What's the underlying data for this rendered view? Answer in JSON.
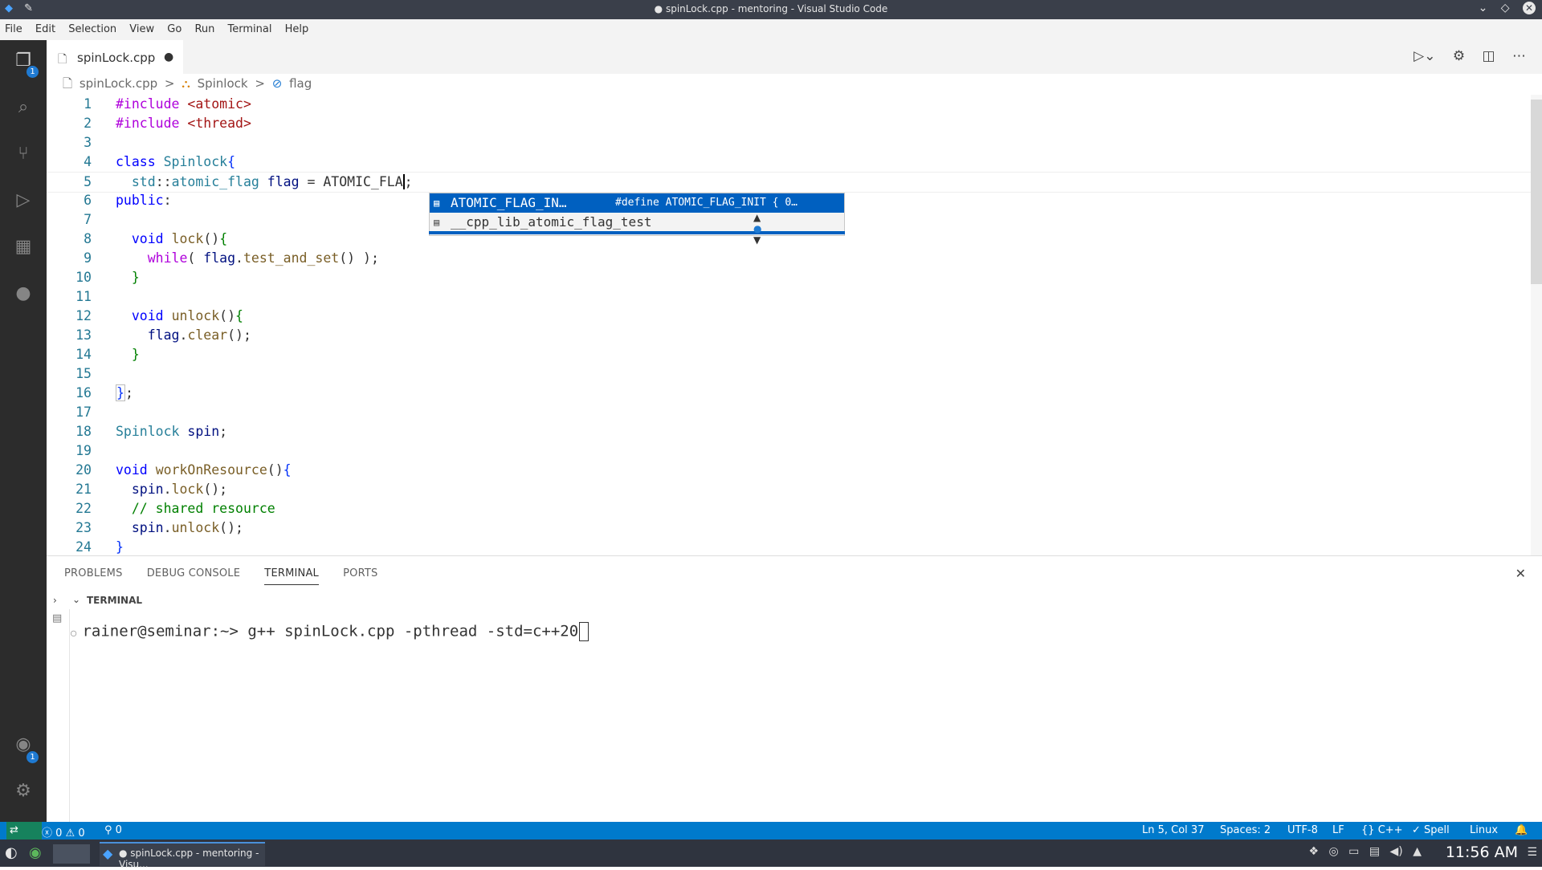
{
  "window": {
    "title": "● spinLock.cpp - mentoring - Visual Studio Code"
  },
  "menu": [
    "File",
    "Edit",
    "Selection",
    "View",
    "Go",
    "Run",
    "Terminal",
    "Help"
  ],
  "activity": {
    "icons": [
      "files-icon",
      "search-icon",
      "source-control-icon",
      "run-debug-icon",
      "extensions-icon",
      "github-icon"
    ],
    "explorer_badge": "1",
    "accounts_badge": "1"
  },
  "tab": {
    "label": "spinLock.cpp",
    "modified": "●"
  },
  "breadcrumb": {
    "file": "spinLock.cpp",
    "sep": ">",
    "class": "Spinlock",
    "member": "flag"
  },
  "code": {
    "line_numbers": [
      "1",
      "2",
      "3",
      "4",
      "5",
      "6",
      "7",
      "8",
      "9",
      "10",
      "11",
      "12",
      "13",
      "14",
      "15",
      "16",
      "17",
      "18",
      "19",
      "20",
      "21",
      "22",
      "23",
      "24"
    ]
  },
  "suggest": {
    "items": [
      {
        "label": "ATOMIC_FLAG_IN…",
        "detail": "#define ATOMIC_FLAG_INIT { 0…",
        "icon": "text-icon"
      },
      {
        "label": "__cpp_lib_atomic_flag_test",
        "detail": "",
        "icon": "text-icon"
      }
    ]
  },
  "panel": {
    "tabs": [
      "PROBLEMS",
      "DEBUG CONSOLE",
      "TERMINAL",
      "PORTS"
    ],
    "active": "TERMINAL",
    "section": "TERMINAL",
    "terminal_line": "rainer@seminar:~> g++ spinLock.cpp -pthread -std=c++20"
  },
  "status": {
    "errors": "0",
    "warnings": "0",
    "ports": "0",
    "position": "Ln 5, Col 37",
    "spaces": "Spaces: 2",
    "encoding": "UTF-8",
    "eol": "LF",
    "language": "C++",
    "spell": "Spell",
    "platform": "Linux"
  },
  "taskbar": {
    "window_label": "● spinLock.cpp - mentoring - Visu...",
    "clock": "11:56 AM"
  },
  "colors": {
    "accent": "#007acc",
    "selection": "#0060c0",
    "activitybar": "#2c2c2c"
  }
}
